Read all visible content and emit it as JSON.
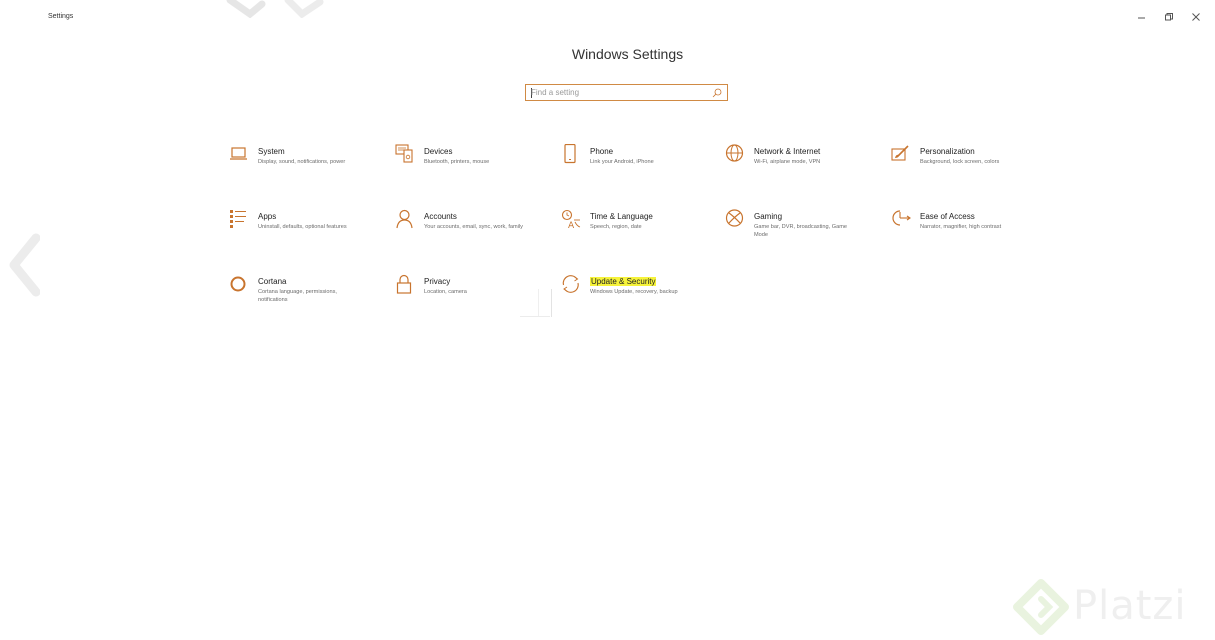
{
  "window": {
    "app_title": "Settings",
    "controls": [
      {
        "name": "minimize",
        "glyph": "–"
      },
      {
        "name": "restore",
        "glyph": "◻"
      },
      {
        "name": "close",
        "glyph": "✕"
      }
    ]
  },
  "header": {
    "title": "Windows Settings"
  },
  "search": {
    "placeholder": "Find a setting",
    "value": "",
    "icon": "search-icon"
  },
  "accent_color": "#c8742e",
  "highlight_color": "#f6f33a",
  "categories": [
    {
      "id": "system",
      "name": "System",
      "description": "Display, sound, notifications, power",
      "icon": "laptop-icon"
    },
    {
      "id": "devices",
      "name": "Devices",
      "description": "Bluetooth, printers, mouse",
      "icon": "devices-icon"
    },
    {
      "id": "phone",
      "name": "Phone",
      "description": "Link your Android, iPhone",
      "icon": "phone-icon"
    },
    {
      "id": "network",
      "name": "Network & Internet",
      "description": "Wi-Fi, airplane mode, VPN",
      "icon": "globe-icon"
    },
    {
      "id": "personalization",
      "name": "Personalization",
      "description": "Background, lock screen, colors",
      "icon": "paintbrush-icon"
    },
    {
      "id": "apps",
      "name": "Apps",
      "description": "Uninstall, defaults, optional features",
      "icon": "apps-list-icon"
    },
    {
      "id": "accounts",
      "name": "Accounts",
      "description": "Your accounts, email, sync, work, family",
      "icon": "person-icon"
    },
    {
      "id": "time",
      "name": "Time & Language",
      "description": "Speech, region, date",
      "icon": "time-language-icon"
    },
    {
      "id": "gaming",
      "name": "Gaming",
      "description": "Game bar, DVR, broadcasting, Game Mode",
      "icon": "xbox-icon"
    },
    {
      "id": "ease",
      "name": "Ease of Access",
      "description": "Narrator, magnifier, high contrast",
      "icon": "ease-of-access-icon"
    },
    {
      "id": "cortana",
      "name": "Cortana",
      "description": "Cortana language, permissions, notifications",
      "icon": "cortana-ring-icon"
    },
    {
      "id": "privacy",
      "name": "Privacy",
      "description": "Location, camera",
      "icon": "lock-icon"
    },
    {
      "id": "update",
      "name": "Update & Security",
      "description": "Windows Update, recovery, backup",
      "icon": "sync-arrows-icon",
      "highlighted": true
    }
  ],
  "navigation": {
    "back_icon": "chevron-left-icon"
  },
  "watermark": {
    "text": "Platzi",
    "icon": "platzi-logo-icon"
  }
}
